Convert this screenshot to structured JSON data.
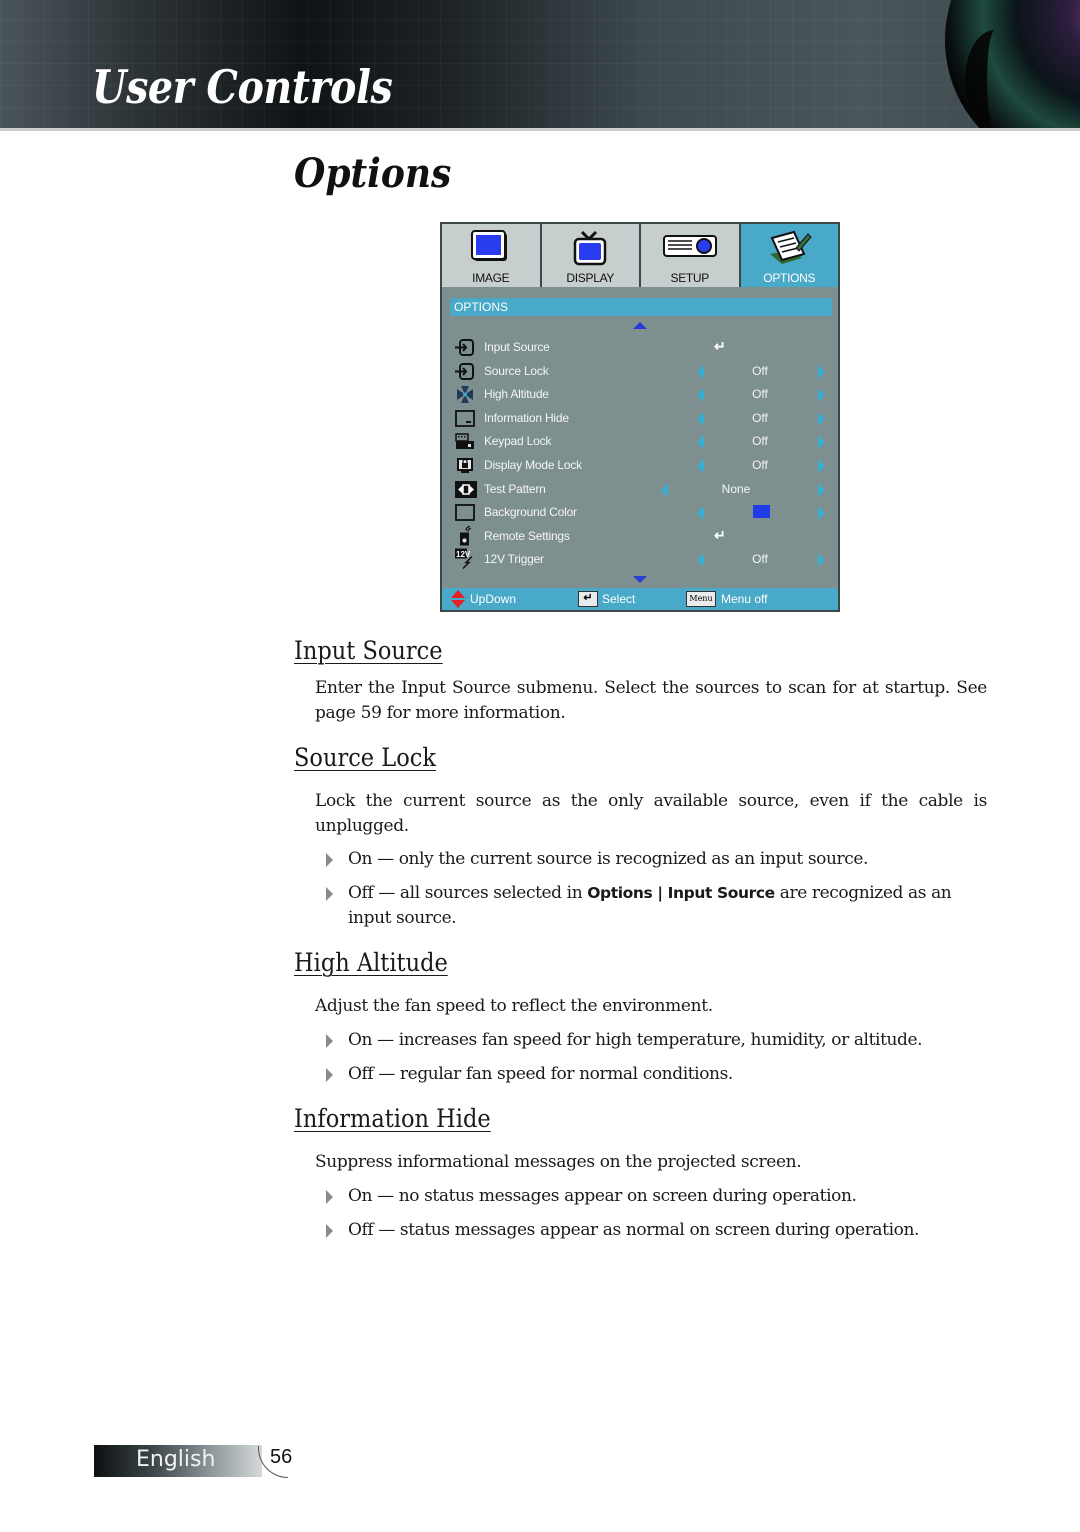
{
  "header": {
    "section_title": "User Controls",
    "page_heading": "Options"
  },
  "osd": {
    "tabs": [
      {
        "label": "IMAGE",
        "icon": "image-icon",
        "active": false
      },
      {
        "label": "DISPLAY",
        "icon": "tv-icon",
        "active": false
      },
      {
        "label": "SETUP",
        "icon": "projector-icon",
        "active": false
      },
      {
        "label": "OPTIONS",
        "icon": "notepad-icon",
        "active": true
      }
    ],
    "title": "OPTIONS",
    "items": [
      {
        "label": "Input Source",
        "icon": "input-icon",
        "value": "↵",
        "type": "enter"
      },
      {
        "label": "Source Lock",
        "icon": "input-icon",
        "value": "Off",
        "type": "select"
      },
      {
        "label": "High Altitude",
        "icon": "fan-icon",
        "value": "Off",
        "type": "select"
      },
      {
        "label": "Information Hide",
        "icon": "info-hide-icon",
        "value": "Off",
        "type": "select"
      },
      {
        "label": "Keypad Lock",
        "icon": "keypad-icon",
        "value": "Off",
        "type": "select"
      },
      {
        "label": "Display Mode Lock",
        "icon": "display-lock-icon",
        "value": "Off",
        "type": "select"
      },
      {
        "label": "Test Pattern",
        "icon": "test-pattern-icon",
        "value": "None",
        "type": "select-wide"
      },
      {
        "label": "Background Color",
        "icon": "background-color-icon",
        "value": "",
        "swatch": "#1f3de6",
        "type": "color"
      },
      {
        "label": "Remote Settings",
        "icon": "remote-icon",
        "value": "↵",
        "type": "enter"
      },
      {
        "label": "12V Trigger",
        "icon": "trigger-icon",
        "value": "Off",
        "type": "select"
      }
    ],
    "footer": {
      "updown_label": "UpDown",
      "select_label": "Select",
      "select_key": "↵",
      "menu_key": "Menu",
      "menu_label": "Menu off"
    },
    "colors": {
      "accent": "#49a9c8",
      "panel": "#7d8f8e",
      "arrow": "#2a3cd6"
    }
  },
  "sections": {
    "input_source": {
      "heading": "Input Source",
      "text": "Enter the Input Source submenu. Select the sources to scan for at startup. See page 59 for more information."
    },
    "source_lock": {
      "heading": "Source Lock",
      "text": "Lock the current source as the only available source, even if the cable is unplugged.",
      "bullet_on": "On — only the current source is recognized as an input source.",
      "bullet_off_pre": "Off — all sources selected in ",
      "bullet_off_bold": "Options | Input Source",
      "bullet_off_post": " are recognized as an input source."
    },
    "high_altitude": {
      "heading": "High Altitude",
      "text": "Adjust the fan speed to reflect the environment.",
      "bullet_on": "On — increases fan speed for high temperature, humidity, or altitude.",
      "bullet_off": "Off — regular fan speed for normal conditions."
    },
    "information_hide": {
      "heading": "Information Hide",
      "text": "Suppress informational messages on the projected screen.",
      "bullet_on": "On — no status messages appear on screen during operation.",
      "bullet_off": "Off —  status messages appear as normal on screen during operation."
    }
  },
  "footer": {
    "language": "English",
    "page_number": "56"
  }
}
